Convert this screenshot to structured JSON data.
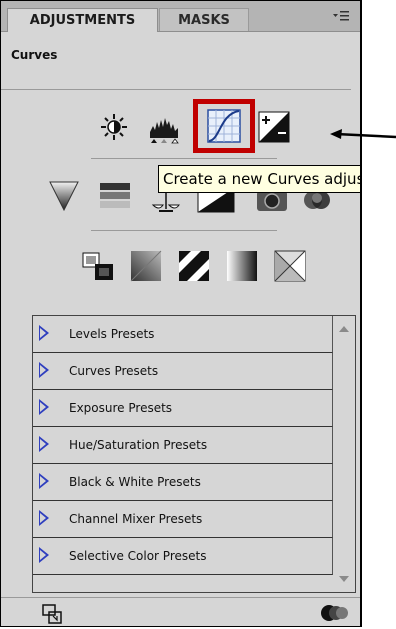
{
  "tabs": {
    "adjustments": "ADJUSTMENTS",
    "masks": "MASKS"
  },
  "panel_menu_icon": "panel-menu-icon",
  "panel": {
    "title": "Curves"
  },
  "tooltip": {
    "text": "Create a new Curves adjustment layer"
  },
  "icons_row1": [
    "brightness-contrast-icon",
    "levels-icon",
    "curves-icon",
    "exposure-icon"
  ],
  "icons_row2": [
    "vibrance-icon",
    "hue-saturation-icon",
    "color-balance-icon",
    "black-white-icon",
    "photo-filter-icon",
    "channel-mixer-icon"
  ],
  "icons_row3": [
    "invert-icon",
    "posterize-icon",
    "threshold-icon",
    "gradient-map-icon",
    "selective-color-icon"
  ],
  "presets": [
    {
      "label": "Levels Presets"
    },
    {
      "label": "Curves Presets"
    },
    {
      "label": "Exposure Presets"
    },
    {
      "label": "Hue/Saturation Presets"
    },
    {
      "label": "Black & White Presets"
    },
    {
      "label": "Channel Mixer Presets"
    },
    {
      "label": "Selective Color Presets"
    }
  ],
  "colors": {
    "highlight": "#c00000",
    "triangle": "#2f3fbf",
    "tooltip_bg": "#ffffe1"
  }
}
